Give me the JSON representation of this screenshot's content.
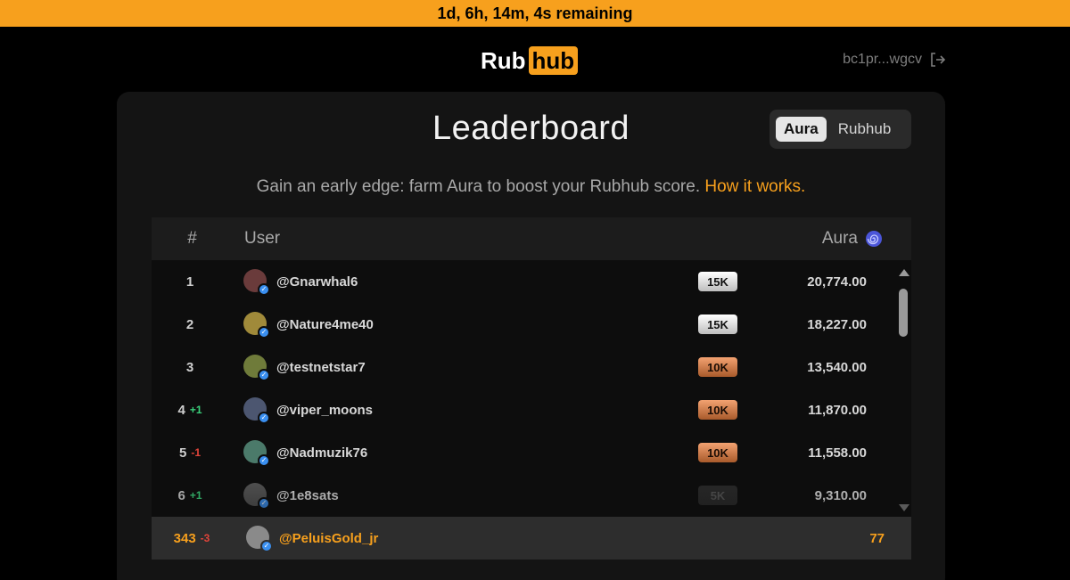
{
  "banner": {
    "countdown": "1d, 6h, 14m, 4s remaining"
  },
  "header": {
    "logo_left": "Rub",
    "logo_right": "hub",
    "wallet": "bc1pr...wgcv",
    "logout_icon": "logout-icon"
  },
  "leaderboard": {
    "title": "Leaderboard",
    "toggle": {
      "options": [
        "Aura",
        "Rubhub"
      ],
      "selected": "Aura"
    },
    "subtitle": "Gain an early edge: farm Aura to boost your Rubhub score.",
    "subtitle_link": "How it works.",
    "columns": {
      "rank": "#",
      "user": "User",
      "aura": "Aura"
    },
    "aura_icon": "spiral-icon",
    "rows": [
      {
        "rank": "1",
        "delta": "",
        "user": "@Gnarwhal6",
        "badge": "15K",
        "tier": "silver",
        "score": "20,774.00",
        "avatar_color": "#6a3b3b"
      },
      {
        "rank": "2",
        "delta": "",
        "user": "@Nature4me40",
        "badge": "15K",
        "tier": "silver",
        "score": "18,227.00",
        "avatar_color": "#a08a3a"
      },
      {
        "rank": "3",
        "delta": "",
        "user": "@testnetstar7",
        "badge": "10K",
        "tier": "bronze",
        "score": "13,540.00",
        "avatar_color": "#6f7b3a"
      },
      {
        "rank": "4",
        "delta": "+1",
        "direction": "up",
        "user": "@viper_moons",
        "badge": "10K",
        "tier": "bronze",
        "score": "11,870.00",
        "avatar_color": "#4c5670"
      },
      {
        "rank": "5",
        "delta": "-1",
        "direction": "down",
        "user": "@Nadmuzik76",
        "badge": "10K",
        "tier": "bronze",
        "score": "11,558.00",
        "avatar_color": "#4b7a6a"
      },
      {
        "rank": "6",
        "delta": "+1",
        "direction": "up",
        "user": "@1e8sats",
        "badge": "5K",
        "tier": "dark",
        "score": "9,310.00",
        "avatar_color": "#555555"
      }
    ],
    "current_user": {
      "rank": "343",
      "delta": "-3",
      "direction": "down",
      "user": "@PeluisGold_jr",
      "score": "77",
      "avatar_color": "#8a8a8a"
    }
  },
  "colors": {
    "accent": "#f7a01d",
    "background": "#000000",
    "card": "#141414",
    "up": "#3ad07a",
    "down": "#e0443a",
    "verified": "#3a8ff0"
  }
}
